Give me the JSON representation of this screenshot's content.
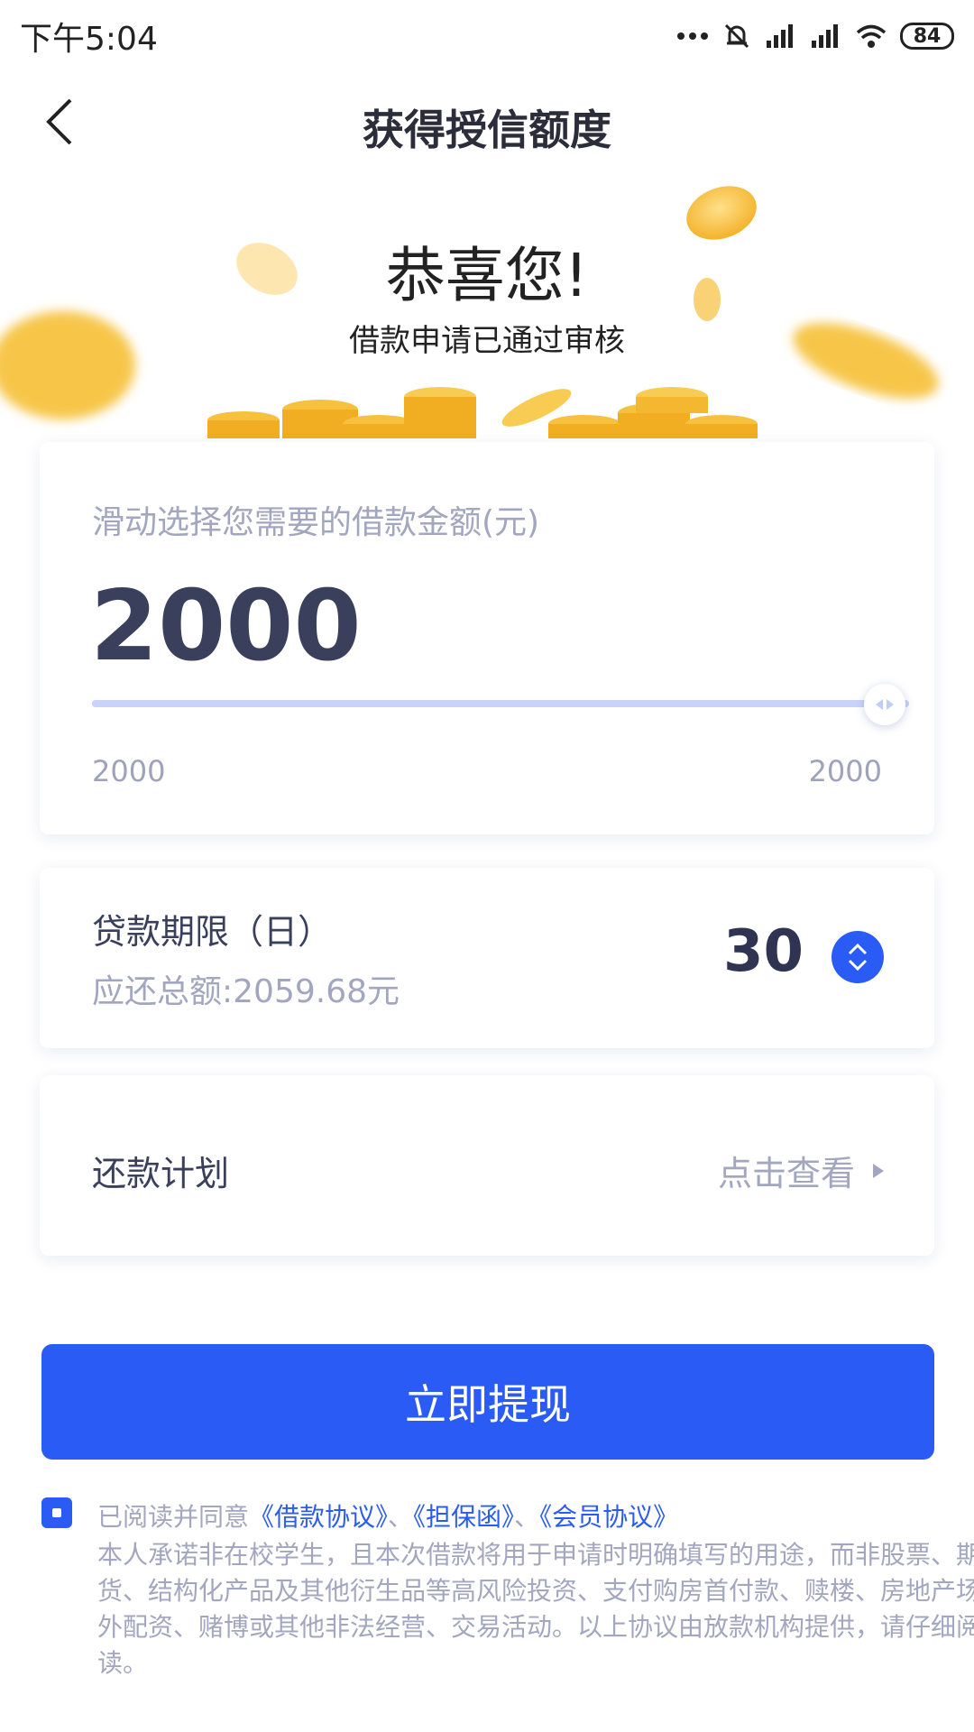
{
  "status_bar": {
    "time": "下午5:04",
    "battery": "84"
  },
  "header": {
    "title": "获得授信额度"
  },
  "hero": {
    "title": "恭喜您!",
    "subtitle": "借款申请已通过审核"
  },
  "amount": {
    "label": "滑动选择您需要的借款金额(元)",
    "value": "2000",
    "min_label": "2000",
    "max_label": "2000",
    "slider_fraction": 1.0
  },
  "term": {
    "label": "贷款期限（日）",
    "total": "应还总额:2059.68元",
    "value": "30"
  },
  "plan": {
    "label": "还款计划",
    "link": "点击查看"
  },
  "actions": {
    "withdraw": "立即提现"
  },
  "agreement": {
    "prefix": "已阅读并同意",
    "links": [
      "《借款协议》",
      "《担保函》",
      "《会员协议》"
    ],
    "separator": "、",
    "disclaimer": "本人承诺非在校学生，且本次借款将用于申请时明确填写的用途，而非股票、期货、结构化产品及其他衍生品等高风险投资、支付购房首付款、赎楼、房地产场外配资、赌博或其他非法经营、交易活动。以上协议由放款机构提供，请仔细阅读。",
    "checked": true
  },
  "colors": {
    "primary": "#2a5cf5",
    "text": "#2f3452",
    "muted": "#a2a6bf",
    "coin": "#f5c242"
  }
}
